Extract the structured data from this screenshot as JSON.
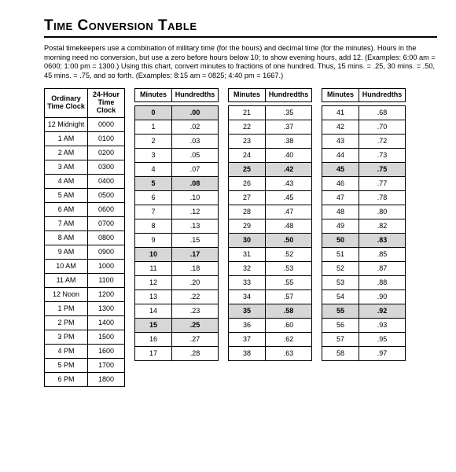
{
  "title": "Time Conversion Table",
  "intro": "Postal timekeepers use a combination of military time (for the hours) and decimal time (for the minutes). Hours in the morning need no conversion, but use a zero before hours below 10; to show evening hours, add 12. (Examples: 6:00 am = 0600; 1:00 pm = 1300.) Using this chart, convert minutes to fractions of one hundred. Thus, 15 mins. = .25, 30 mins. = .50, 45 mins. = .75, and so forth. (Examples: 8:15 am = 0825; 4:40 pm = 1667.)",
  "clock_headers": {
    "ord": "Ordinary Time Clock",
    "mil": "24-Hour Time Clock"
  },
  "min_headers": {
    "min": "Minutes",
    "hun": "Hundredths"
  },
  "clock_rows": [
    {
      "ord": "12 Midnight",
      "mil": "0000"
    },
    {
      "ord": "1 AM",
      "mil": "0100"
    },
    {
      "ord": "2 AM",
      "mil": "0200"
    },
    {
      "ord": "3 AM",
      "mil": "0300"
    },
    {
      "ord": "4 AM",
      "mil": "0400"
    },
    {
      "ord": "5 AM",
      "mil": "0500"
    },
    {
      "ord": "6 AM",
      "mil": "0600"
    },
    {
      "ord": "7 AM",
      "mil": "0700"
    },
    {
      "ord": "8 AM",
      "mil": "0800"
    },
    {
      "ord": "9 AM",
      "mil": "0900"
    },
    {
      "ord": "10 AM",
      "mil": "1000"
    },
    {
      "ord": "11 AM",
      "mil": "1100"
    },
    {
      "ord": "12 Noon",
      "mil": "1200"
    },
    {
      "ord": "1 PM",
      "mil": "1300"
    },
    {
      "ord": "2 PM",
      "mil": "1400"
    },
    {
      "ord": "3 PM",
      "mil": "1500"
    },
    {
      "ord": "4 PM",
      "mil": "1600"
    },
    {
      "ord": "5 PM",
      "mil": "1700"
    },
    {
      "ord": "6 PM",
      "mil": "1800"
    }
  ],
  "minute_cols": [
    [
      {
        "min": "0",
        "hun": ".00",
        "shaded": true
      },
      {
        "min": "1",
        "hun": ".02"
      },
      {
        "min": "2",
        "hun": ".03"
      },
      {
        "min": "3",
        "hun": ".05"
      },
      {
        "min": "4",
        "hun": ".07"
      },
      {
        "min": "5",
        "hun": ".08",
        "shaded": true
      },
      {
        "min": "6",
        "hun": ".10"
      },
      {
        "min": "7",
        "hun": ".12"
      },
      {
        "min": "8",
        "hun": ".13"
      },
      {
        "min": "9",
        "hun": ".15"
      },
      {
        "min": "10",
        "hun": ".17",
        "shaded": true
      },
      {
        "min": "11",
        "hun": ".18"
      },
      {
        "min": "12",
        "hun": ".20"
      },
      {
        "min": "13",
        "hun": ".22"
      },
      {
        "min": "14",
        "hun": ".23"
      },
      {
        "min": "15",
        "hun": ".25",
        "shaded": true
      },
      {
        "min": "16",
        "hun": ".27"
      },
      {
        "min": "17",
        "hun": ".28"
      }
    ],
    [
      {
        "min": "21",
        "hun": ".35"
      },
      {
        "min": "22",
        "hun": ".37"
      },
      {
        "min": "23",
        "hun": ".38"
      },
      {
        "min": "24",
        "hun": ".40"
      },
      {
        "min": "25",
        "hun": ".42",
        "shaded": true
      },
      {
        "min": "26",
        "hun": ".43"
      },
      {
        "min": "27",
        "hun": ".45"
      },
      {
        "min": "28",
        "hun": ".47"
      },
      {
        "min": "29",
        "hun": ".48"
      },
      {
        "min": "30",
        "hun": ".50",
        "shaded": true
      },
      {
        "min": "31",
        "hun": ".52"
      },
      {
        "min": "32",
        "hun": ".53"
      },
      {
        "min": "33",
        "hun": ".55"
      },
      {
        "min": "34",
        "hun": ".57"
      },
      {
        "min": "35",
        "hun": ".58",
        "shaded": true
      },
      {
        "min": "36",
        "hun": ".60"
      },
      {
        "min": "37",
        "hun": ".62"
      },
      {
        "min": "38",
        "hun": ".63"
      }
    ],
    [
      {
        "min": "41",
        "hun": ".68"
      },
      {
        "min": "42",
        "hun": ".70"
      },
      {
        "min": "43",
        "hun": ".72"
      },
      {
        "min": "44",
        "hun": ".73"
      },
      {
        "min": "45",
        "hun": ".75",
        "shaded": true
      },
      {
        "min": "46",
        "hun": ".77"
      },
      {
        "min": "47",
        "hun": ".78"
      },
      {
        "min": "48",
        "hun": ".80"
      },
      {
        "min": "49",
        "hun": ".82"
      },
      {
        "min": "50",
        "hun": ".83",
        "shaded": true
      },
      {
        "min": "51",
        "hun": ".85"
      },
      {
        "min": "52",
        "hun": ".87"
      },
      {
        "min": "53",
        "hun": ".88"
      },
      {
        "min": "54",
        "hun": ".90"
      },
      {
        "min": "55",
        "hun": ".92",
        "shaded": true
      },
      {
        "min": "56",
        "hun": ".93"
      },
      {
        "min": "57",
        "hun": ".95"
      },
      {
        "min": "58",
        "hun": ".97"
      }
    ]
  ]
}
